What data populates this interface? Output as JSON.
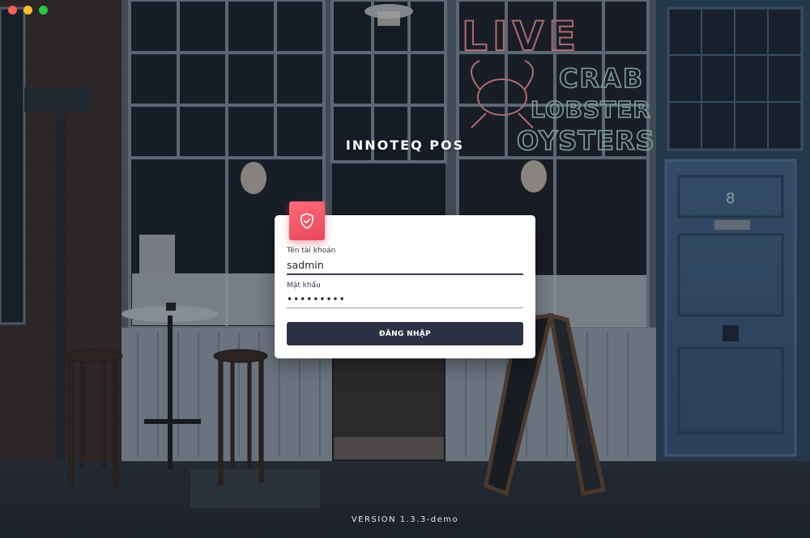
{
  "window": {
    "controls": [
      "close",
      "minimize",
      "maximize"
    ]
  },
  "app": {
    "brand": "INNOTEQ POS",
    "version": "VERSION 1.3.3-demo"
  },
  "login": {
    "badge_icon": "shield-check-icon",
    "username_label": "Tên tài khoản",
    "username_value": "sadmin",
    "password_label": "Mật khẩu",
    "password_value": "•••••••••",
    "submit_label": "ĐĂNG NHẬP"
  },
  "background": {
    "neon_sign_lines": [
      "LIVE",
      "CRAB",
      "LOBSTER",
      "OYSTERS"
    ],
    "door_number": "8"
  },
  "colors": {
    "accent": "#e8475a",
    "button": "#2a3142",
    "neon": "#ff8b8b",
    "door": "#3c6388"
  }
}
